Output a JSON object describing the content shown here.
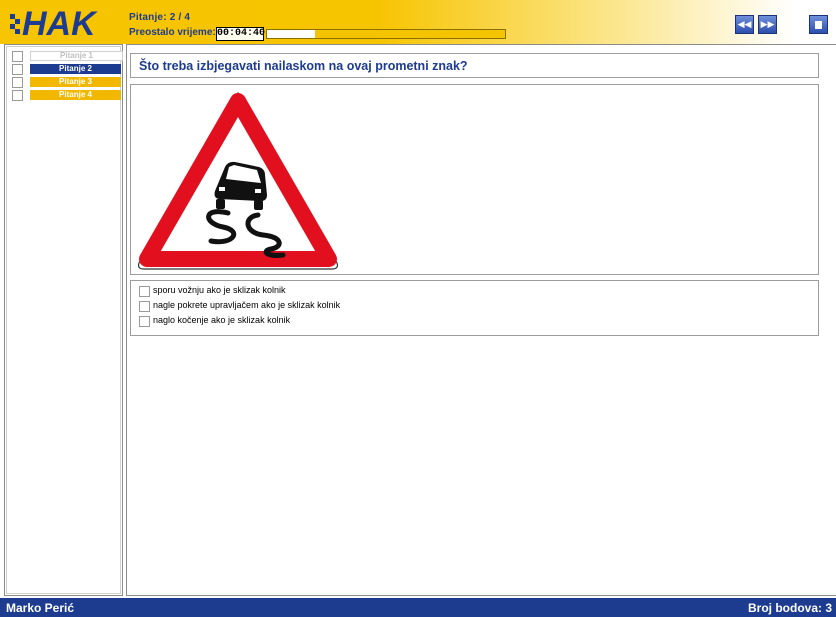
{
  "header": {
    "logo_text": "HAK",
    "question_label": "Pitanje:",
    "question_counter": "2 / 4",
    "time_label": "Preostalo vrijeme:",
    "time_value": "00:04:40",
    "time_progress_remaining": 0.2,
    "colors": {
      "header_yellow": "#f6c400",
      "text_blue": "#1d3b8f",
      "logo_blue": "#1d3b8f"
    }
  },
  "toolbar": {
    "prev_icon": "rewind-icon",
    "next_icon": "fast-forward-icon",
    "stop_icon": "stop-icon"
  },
  "sidebar": {
    "items": [
      {
        "label": "Pitanje 1",
        "state": "answered"
      },
      {
        "label": "Pitanje 2",
        "state": "current"
      },
      {
        "label": "Pitanje 3",
        "state": "unanswered"
      },
      {
        "label": "Pitanje 4",
        "state": "unanswered"
      }
    ]
  },
  "main": {
    "question": "Što treba izbjegavati nailaskom na ovaj prometni znak?",
    "image": "slippery-road-sign",
    "answers": [
      {
        "text": "sporu vožnju ako je sklizak kolnik",
        "checked": false
      },
      {
        "text": "nagle pokrete upravljačem ako je sklizak kolnik",
        "checked": false
      },
      {
        "text": "naglo kočenje ako je sklizak kolnik",
        "checked": false
      }
    ]
  },
  "footer": {
    "user_name": "Marko Perić",
    "score": "Broj bodova: 3"
  }
}
